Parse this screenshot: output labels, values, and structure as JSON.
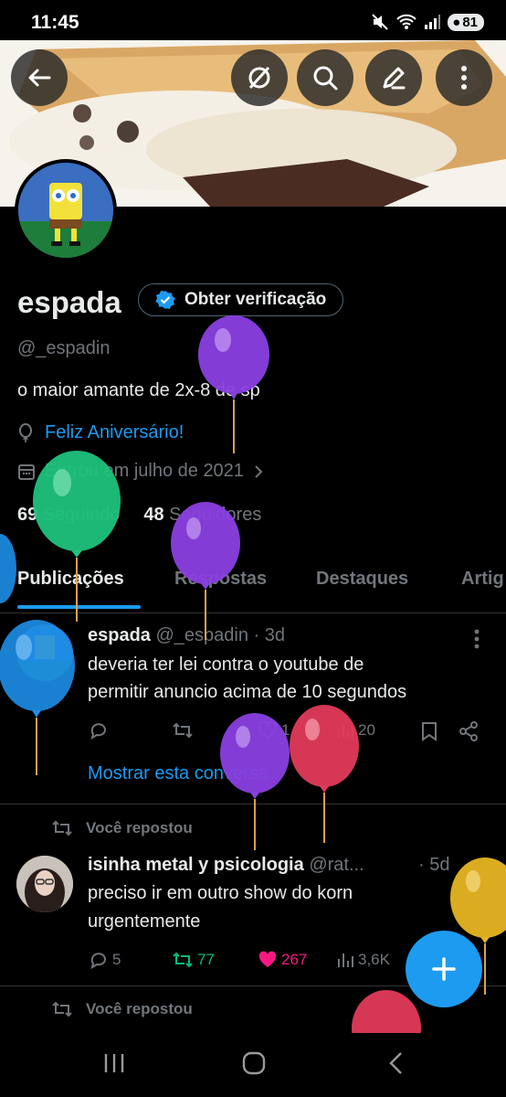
{
  "status_bar": {
    "time": "11:45",
    "battery": "81"
  },
  "colors": {
    "accent": "#1d9bf0",
    "like": "#f91880",
    "retweet": "#00ba7c",
    "muted": "#71767b"
  },
  "header_buttons": [
    "back-arrow-icon",
    "no-image-icon",
    "search-icon",
    "edit-icon",
    "more-vertical-icon"
  ],
  "profile": {
    "name": "espada",
    "verify_label": "Obter verificação",
    "handle": "@_espadin",
    "bio": "o maior amante de 2x-8 de sp",
    "birthday": "Feliz Aniversário!",
    "joined": "Entrou em julho de 2021",
    "following_count": "69",
    "following_label": "Seguindo",
    "followers_count": "48",
    "followers_label": "Seguidores"
  },
  "tabs": [
    "Publicações",
    "Respostas",
    "Destaques",
    "Artig"
  ],
  "tweet1": {
    "name": "espada",
    "handle": "@_espadin",
    "time": "· 3d",
    "line1": "deveria ter lei contra o youtube de",
    "line2": "permitir anuncio acima de 10 segundos",
    "views": "20",
    "likes": "1",
    "show_thread": "Mostrar esta conversa"
  },
  "repost_label": "Você repostou",
  "tweet2": {
    "name": "isinha metal y psicologia",
    "handle": "@rat...",
    "time": "· 5d",
    "line1": "preciso ir em outro show do korn",
    "line2": "urgentemente",
    "replies": "5",
    "retweets": "77",
    "likes": "267",
    "views": "3,6K"
  },
  "repost_label_2": "Você repostou"
}
